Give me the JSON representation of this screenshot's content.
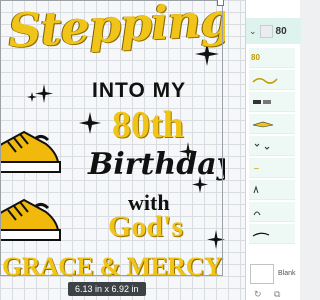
{
  "artwork": {
    "line1": "Stepping",
    "line2": "INTO MY",
    "line3": "80th",
    "line4": "Birthday",
    "line5": "with",
    "line6": "God's",
    "line7": "GRACE & MERCY"
  },
  "canvas": {
    "size_readout": "6.13  in x 6.92  in"
  },
  "layers_panel": {
    "group_label": "80",
    "row_labels": [
      "80",
      "",
      "",
      "",
      "",
      "",
      "",
      "",
      ""
    ],
    "blank_label": "Blank",
    "colors": {
      "accent": "#2aa58d",
      "row_bg": "#dff3ee",
      "gold": "#f0c419"
    }
  }
}
